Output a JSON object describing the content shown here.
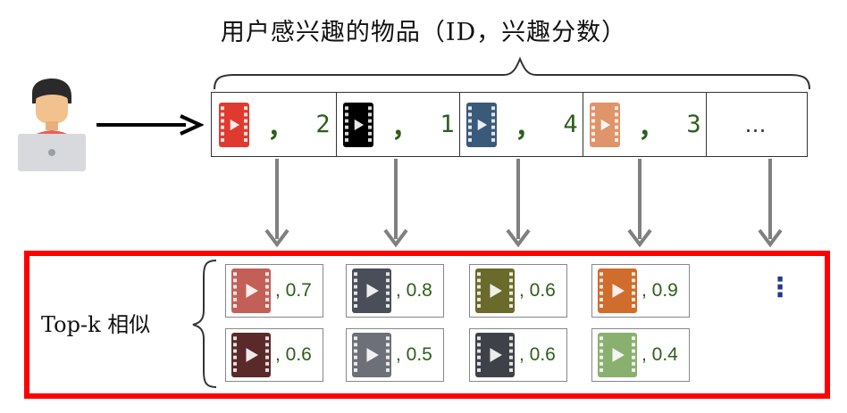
{
  "title": "用户感兴趣的物品（ID，兴趣分数）",
  "icons": {
    "user": "user-at-laptop-icon",
    "film": "film-strip-play-icon"
  },
  "sequence": {
    "items": [
      {
        "score": "2",
        "color": "#e03a2f",
        "bg": "#e03a2f"
      },
      {
        "score": "1",
        "color": "#000000",
        "bg": "#000000"
      },
      {
        "score": "4",
        "color": "#3a5a7a",
        "bg": "#3a5a7a"
      },
      {
        "score": "3",
        "color": "#e0946a",
        "bg": "#e0946a"
      }
    ],
    "comma": "，",
    "more": "…"
  },
  "similar": {
    "label": "Top-k 相似",
    "columns": [
      [
        {
          "value": ", 0.7",
          "color": "#c26058"
        },
        {
          "value": ", 0.6",
          "color": "#5a2a2a"
        }
      ],
      [
        {
          "value": ", 0.8",
          "color": "#4a4e58"
        },
        {
          "value": ", 0.5",
          "color": "#6d7078"
        }
      ],
      [
        {
          "value": ", 0.6",
          "color": "#6a6a2a"
        },
        {
          "value": ", 0.6",
          "color": "#3e4248"
        }
      ],
      [
        {
          "value": ", 0.9",
          "color": "#d06c2c"
        },
        {
          "value": ", 0.4",
          "color": "#8ab070"
        }
      ]
    ],
    "more": "⋮"
  },
  "colors": {
    "highlight_border": "#ff0000",
    "score_text": "#2e5d1b",
    "connector_arrows": "#808080"
  }
}
